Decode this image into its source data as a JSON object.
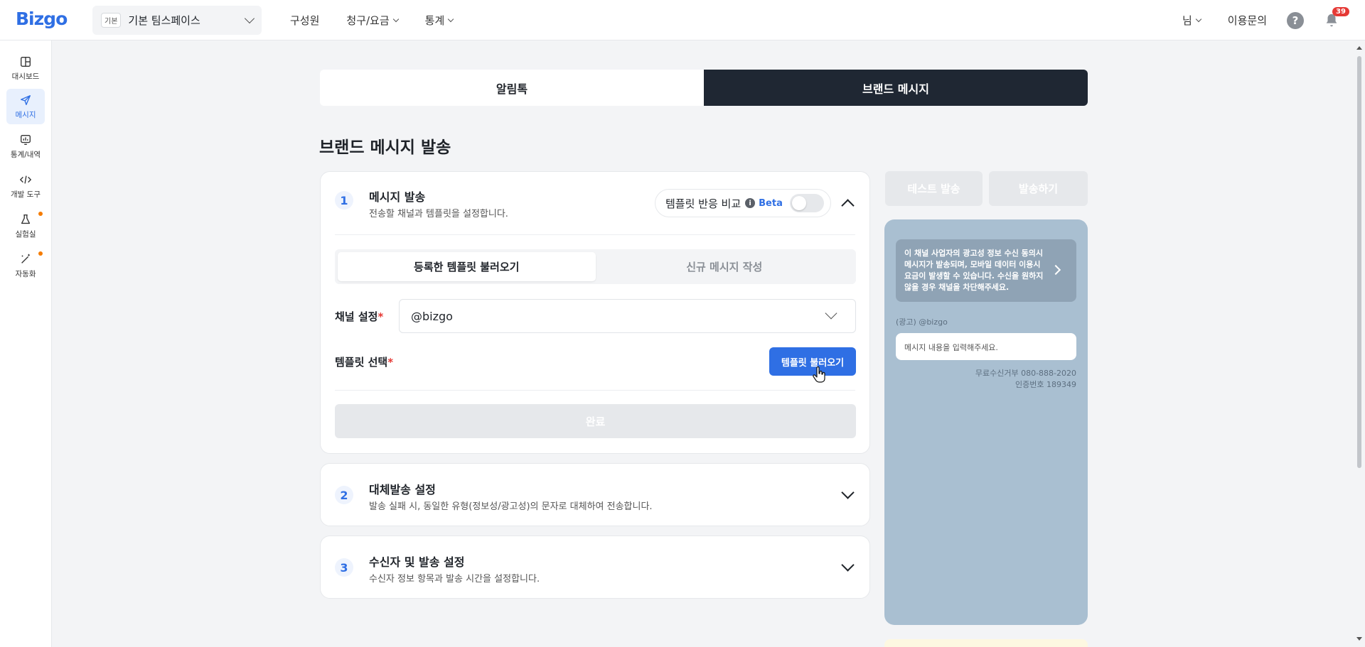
{
  "app": {
    "logo": "Bizgo"
  },
  "workspace": {
    "badge": "기본",
    "name": "기본 팀스페이스"
  },
  "topnav": {
    "members": "구성원",
    "billing": "청구/요금",
    "stats": "통계"
  },
  "topright": {
    "user": "님",
    "inquiry": "이용문의",
    "help": "?",
    "notifications": "39"
  },
  "sidebar": {
    "items": [
      {
        "label": "대시보드",
        "icon": "dashboard-icon"
      },
      {
        "label": "메시지",
        "icon": "paper-plane-icon",
        "active": true
      },
      {
        "label": "통계/내역",
        "icon": "chart-icon"
      },
      {
        "label": "개발 도구",
        "icon": "code-icon"
      },
      {
        "label": "실험실",
        "icon": "flask-icon",
        "dot": true
      },
      {
        "label": "자동화",
        "icon": "magic-wand-icon",
        "dot": true
      }
    ]
  },
  "channel_tabs": {
    "alimtalk": "알림톡",
    "brand_message": "브랜드 메시지",
    "active": "brand_message"
  },
  "page": {
    "title": "브랜드 메시지 발송"
  },
  "step1": {
    "num": "1",
    "title": "메시지 발송",
    "desc": "전송할 채널과 템플릿을 설정합니다.",
    "compare_label": "템플릿 반응 비교",
    "beta": "Beta",
    "compare_toggle": "off",
    "tabs": {
      "load": "등록한 템플릿 불러오기",
      "new": "신규 메시지 작성"
    },
    "channel_label": "채널 설정",
    "channel_value": "@bizgo",
    "template_label": "템플릿 선택",
    "template_button": "템플릿 불러오기",
    "done_button": "완료",
    "required_mark": "*"
  },
  "step2": {
    "num": "2",
    "title": "대체발송 설정",
    "desc": "발송 실패 시, 동일한 유형(정보성/광고성)의 문자로 대체하여 전송합니다."
  },
  "step3": {
    "num": "3",
    "title": "수신자 및 발송 설정",
    "desc": "수신자 정보 항목과 발송 시간을 설정합니다."
  },
  "actions": {
    "test_send": "테스트 발송",
    "send": "발송하기"
  },
  "preview": {
    "ad_notice": "이 채널 사업자의 광고성 정보 수신 동의시 메시지가 발송되며, 모바일 데이터 이용시 요금이 발생할 수 있습니다. 수신을 원하지 않을 경우 채널을 차단해주세요.",
    "sender": "(광고) @bizgo",
    "placeholder": "메시지 내용을 입력해주세요.",
    "optout": "무료수신거부 080-888-2020",
    "auth": "인증번호 189349"
  },
  "colors": {
    "accent": "#2f6fe4",
    "dark_tab": "#1f2733",
    "preview_bg": "#a9bfd1"
  }
}
